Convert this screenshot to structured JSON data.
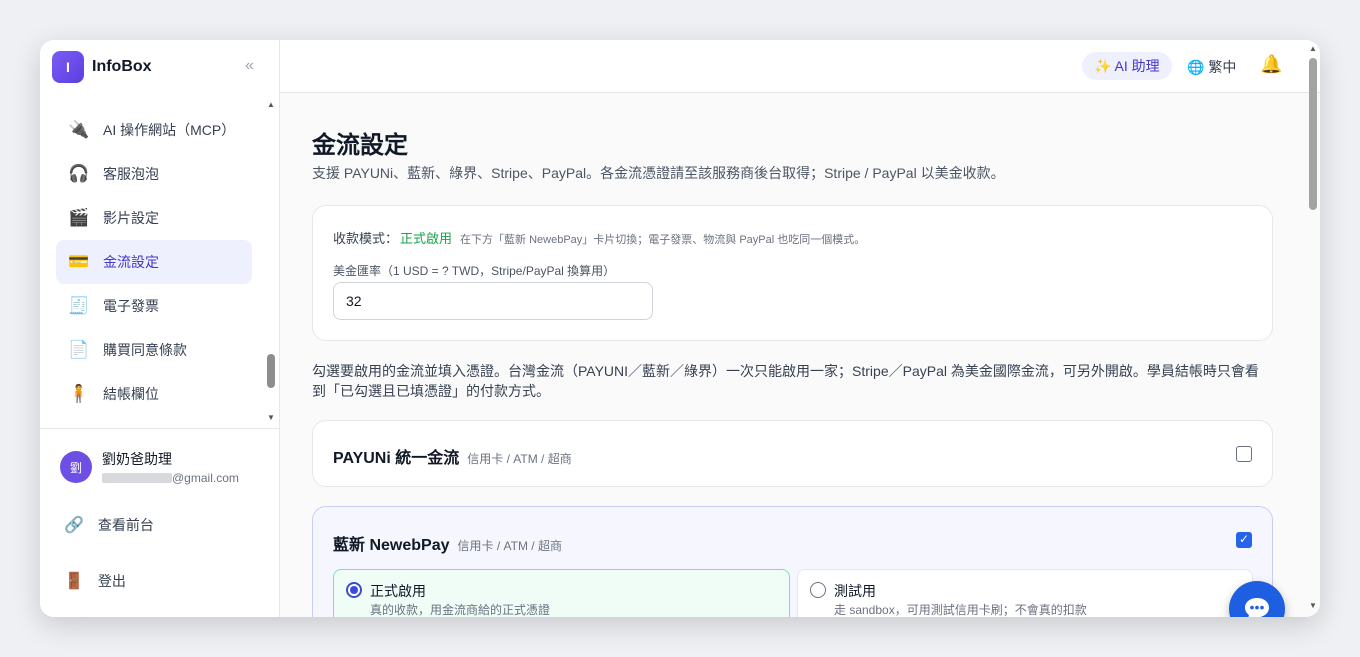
{
  "brand": {
    "logo_letter": "I",
    "name": "InfoBox",
    "collapse_icon": "«"
  },
  "nav": {
    "items": [
      {
        "icon": "🔌",
        "icon_name": "plug-icon",
        "label": "AI 操作網站（MCP）"
      },
      {
        "icon": "🎧",
        "icon_name": "headphones-icon",
        "label": "客服泡泡"
      },
      {
        "icon": "🎬",
        "icon_name": "clapperboard-icon",
        "label": "影片設定"
      },
      {
        "icon": "💳",
        "icon_name": "credit-card-icon",
        "label": "金流設定",
        "active": true
      },
      {
        "icon": "🧾",
        "icon_name": "receipt-icon",
        "label": "電子發票"
      },
      {
        "icon": "📄",
        "icon_name": "document-icon",
        "label": "購買同意條款"
      },
      {
        "icon": "🧍",
        "icon_name": "person-icon",
        "label": "結帳欄位"
      }
    ]
  },
  "user": {
    "avatar": "劉",
    "name": "劉奶爸助理",
    "email_suffix": "@gmail.com"
  },
  "side_links": {
    "frontend": {
      "icon": "🔗",
      "label": "查看前台"
    },
    "logout": {
      "icon": "🚪",
      "label": "登出"
    }
  },
  "topbar": {
    "ai_label": "✨ AI 助理",
    "lang_label": "🌐 繁中",
    "bell": "🔔"
  },
  "page": {
    "title": "金流設定",
    "subtitle": "支援 PAYUNi、藍新、綠界、Stripe、PayPal。各金流憑證請至該服務商後台取得；Stripe / PayPal 以美金收款。"
  },
  "settings": {
    "mode_label": "收款模式：",
    "mode_value": "正式啟用",
    "mode_hint": "在下方「藍新 NewebPay」卡片切換；電子發票、物流與 PayPal 也吃同一個模式。",
    "rate_label": "美金匯率（1 USD = ? TWD，Stripe/PayPal 換算用）",
    "rate_value": "32"
  },
  "description": "勾選要啟用的金流並填入憑證。台灣金流（PAYUNI／藍新／綠界）一次只能啟用一家；Stripe／PayPal 為美金國際金流，可另外開啟。學員結帳時只會看到「已勾選且已填憑證」的付款方式。",
  "providers": [
    {
      "name": "PAYUNi 統一金流",
      "methods": "信用卡 / ATM / 超商",
      "enabled": false
    },
    {
      "name": "藍新 NewebPay",
      "methods": "信用卡 / ATM / 超商",
      "enabled": true,
      "env": {
        "live": {
          "title": "正式啟用",
          "desc": "真的收款，用金流商給的正式憑證",
          "selected": true
        },
        "test": {
          "title": "測試用",
          "desc": "走 sandbox，可用測試信用卡刷；不會真的扣款",
          "selected": false
        }
      }
    }
  ],
  "colors": {
    "accent": "#4338ca",
    "active_bg": "#eef0fe",
    "success": "#16a34a",
    "fab": "#1d5fe0"
  }
}
